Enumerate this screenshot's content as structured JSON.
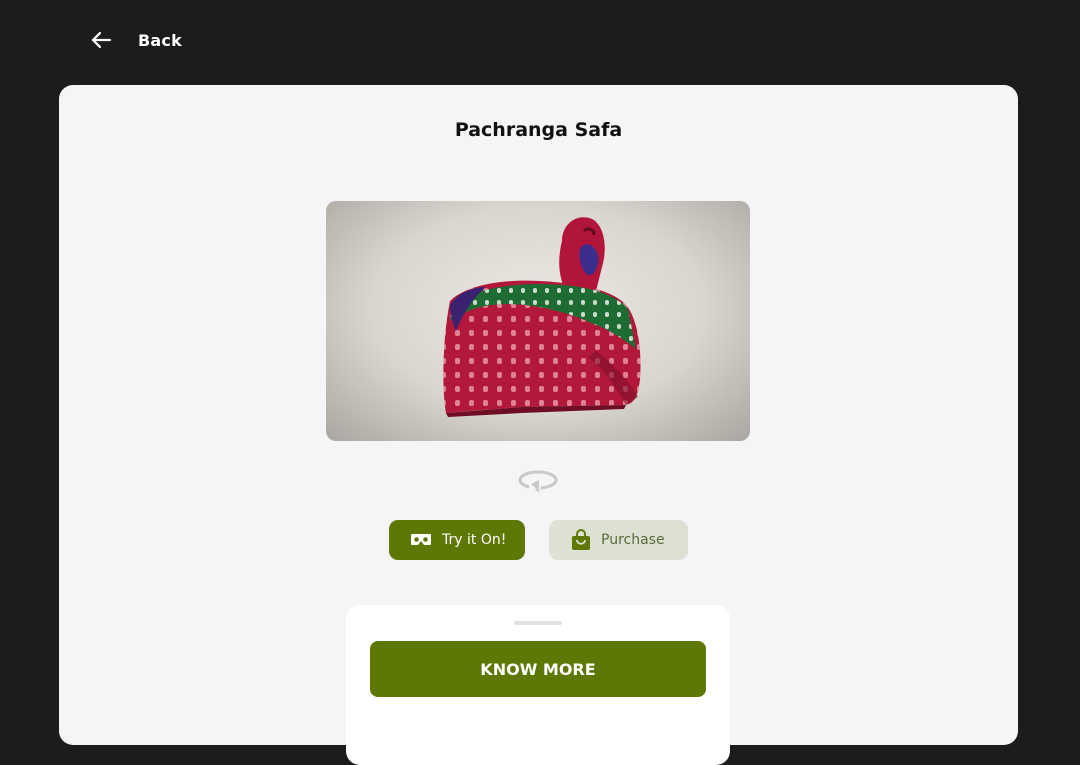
{
  "header": {
    "back_label": "Back",
    "back_icon": "arrow-left-icon"
  },
  "product": {
    "title": "Pachranga Safa",
    "image_subject": "turban-3d-model",
    "rotate_icon": "rotate-360-icon"
  },
  "actions": {
    "try_on_label": "Try it On!",
    "try_on_icon": "vr-headset-icon",
    "purchase_label": "Purchase",
    "purchase_icon": "shopping-bag-icon"
  },
  "sheet": {
    "know_more_label": "KNOW MORE"
  },
  "colors": {
    "page_background": "#1c1c1c",
    "card_background": "#f5f5f7",
    "accent": "#5e7805",
    "accent_light": "#dde1d3"
  }
}
